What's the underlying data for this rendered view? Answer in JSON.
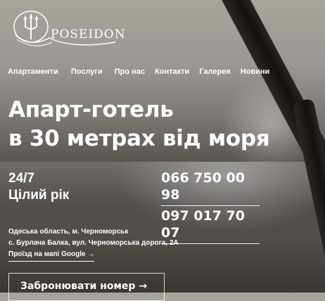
{
  "brand": {
    "logo_text": "POSEIDON"
  },
  "nav": [
    {
      "label": "Апартаменти"
    },
    {
      "label": "Послуги"
    },
    {
      "label": "Про нас"
    },
    {
      "label": "Контакти"
    },
    {
      "label": "Галерея"
    },
    {
      "label": "Новини"
    }
  ],
  "hero": {
    "title_line1": "Апарт-готель",
    "title_line2": "в 30 метрах від моря"
  },
  "hours": {
    "line1": "24/7",
    "line2": "Цілий рік"
  },
  "phones": [
    "066 750 00 98",
    "097 017 70 07"
  ],
  "address": {
    "line1": "Одеська область, м. Черноморськ",
    "line2": "с. Бурлача Балка, вул. Черноморська дорога, 2А",
    "route_link": "Проїзд на мапі Google →"
  },
  "cta": {
    "book_label": "Забронювати номер →"
  },
  "colors": {
    "text": "#ffffff",
    "overlay": "#5a5652"
  }
}
